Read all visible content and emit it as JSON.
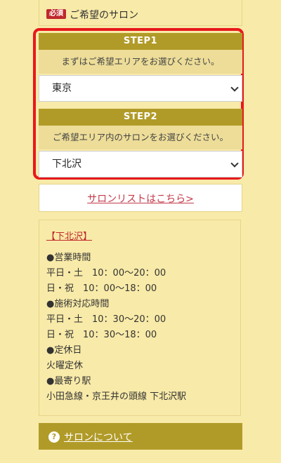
{
  "header": {
    "badge": "必須",
    "label": "ご希望のサロン"
  },
  "step1": {
    "title": "STEP1",
    "description": "まずはご希望エリアをお選びください。",
    "selected": "東京"
  },
  "step2": {
    "title": "STEP2",
    "description": "ご希望エリア内のサロンをお選びください。",
    "selected": "下北沢"
  },
  "salon_list_link": "サロンリストはこちら>",
  "info": {
    "title": "【下北沢】",
    "lines": [
      "●営業時間",
      "平日・土　10：00〜20：00",
      "日・祝　10：00〜18：00",
      "●施術対応時間",
      "平日・土　10：30〜20：00",
      "日・祝　10：30〜18：00",
      "●定休日",
      "火曜定休",
      "●最寄り駅",
      "小田急線・京王井の頭線 下北沢駅"
    ]
  },
  "about": {
    "icon": "?",
    "label": "サロンについて"
  },
  "colors": {
    "background": "#f8eaa8",
    "accent": "#b19b28",
    "highlight_border": "#e8181b",
    "required_badge": "#c0282d"
  }
}
